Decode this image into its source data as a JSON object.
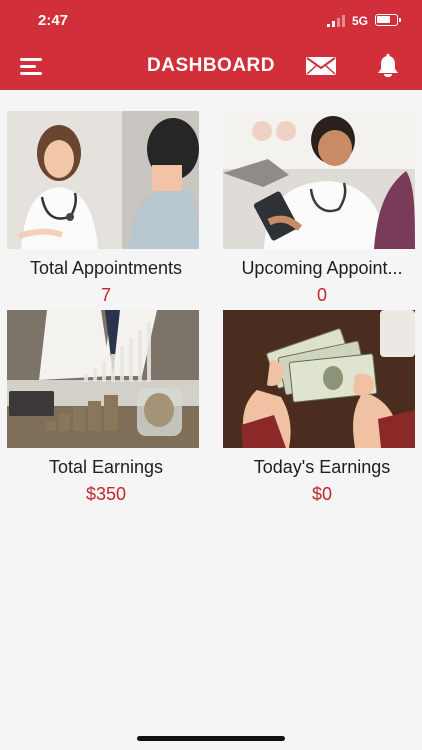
{
  "status_bar": {
    "time": "2:47",
    "network": "5G",
    "battery_level": 0.72
  },
  "header": {
    "title": "DASHBOARD",
    "accent_color": "#d1303a",
    "icons": [
      "menu-icon",
      "mail-icon",
      "bell-icon"
    ]
  },
  "cards": [
    {
      "title": "Total Appointments",
      "value": "7",
      "image": "doctor-consultation-image"
    },
    {
      "title": "Upcoming Appoint...",
      "value": "0",
      "image": "doctor-tablet-image"
    },
    {
      "title": "Total Earnings",
      "value": "$350",
      "image": "coin-stacks-image"
    },
    {
      "title": "Today's Earnings",
      "value": "$0",
      "image": "dollar-bills-image"
    }
  ]
}
